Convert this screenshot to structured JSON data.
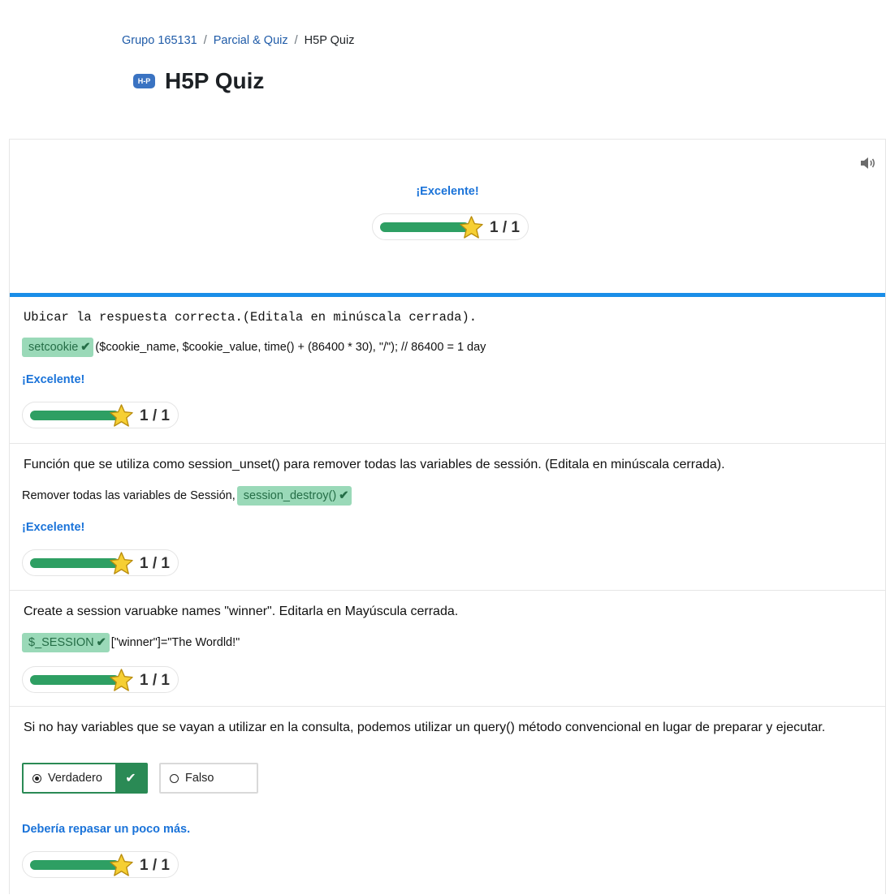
{
  "breadcrumb": {
    "items": [
      "Grupo 165131",
      "Parcial & Quiz",
      "H5P Quiz"
    ],
    "separator": "/"
  },
  "page": {
    "icon_label": "H-P",
    "title": "H5P Quiz"
  },
  "overall": {
    "feedback": "¡Excelente!",
    "score": "1 / 1",
    "progress": 1.0
  },
  "questions": [
    {
      "prompt": "Ubicar la respuesta correcta.(Editala en minúscala cerrada).",
      "answer": "setcookie",
      "after_text": "($cookie_name, $cookie_value, time() + (86400 * 30), \"/\"); // 86400 = 1 day",
      "feedback": "¡Excelente!",
      "score": "1 / 1"
    },
    {
      "prompt": "Función que se utiliza como session_unset() para remover todas las variables de sessión. (Editala en minúscala cerrada).",
      "before_text": "Remover todas las variables de Sessión,",
      "answer": "session_destroy()",
      "feedback": "¡Excelente!",
      "score": "1 / 1"
    },
    {
      "prompt": "Create a session varuabke names \"winner\". Editarla en Mayúscula cerrada.",
      "answer": "$_SESSION",
      "after_text": "[\"winner\"]=\"The Wordld!\"",
      "score": "1 / 1"
    },
    {
      "prompt": "Si no hay variables que se vayan a utilizar en la consulta, podemos utilizar un query() método  convencional en lugar de preparar y ejecutar.",
      "options": [
        "Verdadero",
        "Falso"
      ],
      "feedback": "Debería repasar un poco más.",
      "score": "1 / 1"
    }
  ],
  "colors": {
    "accent_blue": "#1a8ee8",
    "correct_green": "#2a8a55",
    "chip_bg": "#9ad9b8",
    "feedback_blue": "#1a73d9"
  }
}
